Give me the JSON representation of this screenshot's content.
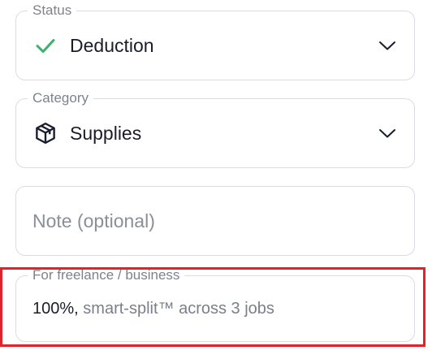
{
  "status": {
    "label": "Status",
    "value": "Deduction",
    "icon": "check-icon",
    "icon_color": "#3db46d"
  },
  "category": {
    "label": "Category",
    "value": "Supplies",
    "icon": "package-icon",
    "icon_color": "#1a1d2a"
  },
  "note": {
    "placeholder": "Note (optional)",
    "value": ""
  },
  "business": {
    "label": "For freelance / business",
    "percent": "100%,",
    "description": "smart-split™ across 3 jobs"
  },
  "colors": {
    "border": "#d9dce1",
    "highlight": "#e0232b",
    "label": "#7d828c",
    "text": "#1a1d2a"
  }
}
